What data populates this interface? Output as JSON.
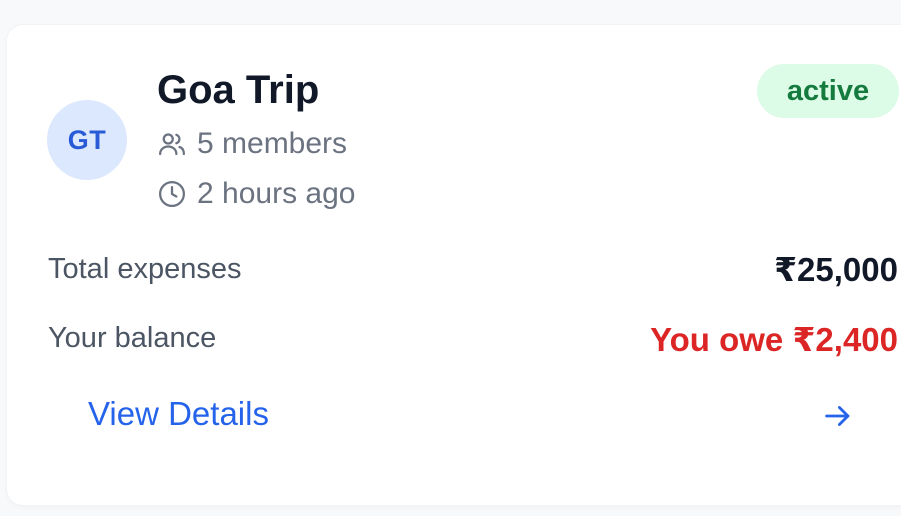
{
  "group": {
    "initials": "GT",
    "name": "Goa Trip",
    "members": "5 members",
    "updated": "2 hours ago",
    "status": "active",
    "icons": {
      "members": "users-icon",
      "updated": "clock-icon",
      "link": "arrow-right-icon"
    }
  },
  "summary": {
    "total_label": "Total expenses",
    "total_value": "₹25,000",
    "balance_label": "Your balance",
    "balance_value": "You owe ₹2,400"
  },
  "actions": {
    "view_details": "View Details"
  },
  "colors": {
    "accent": "#2563eb",
    "owe": "#dc2626",
    "active_bg": "#dcfce7",
    "active_text": "#157a3d",
    "avatar_bg": "#dbe8fd"
  }
}
